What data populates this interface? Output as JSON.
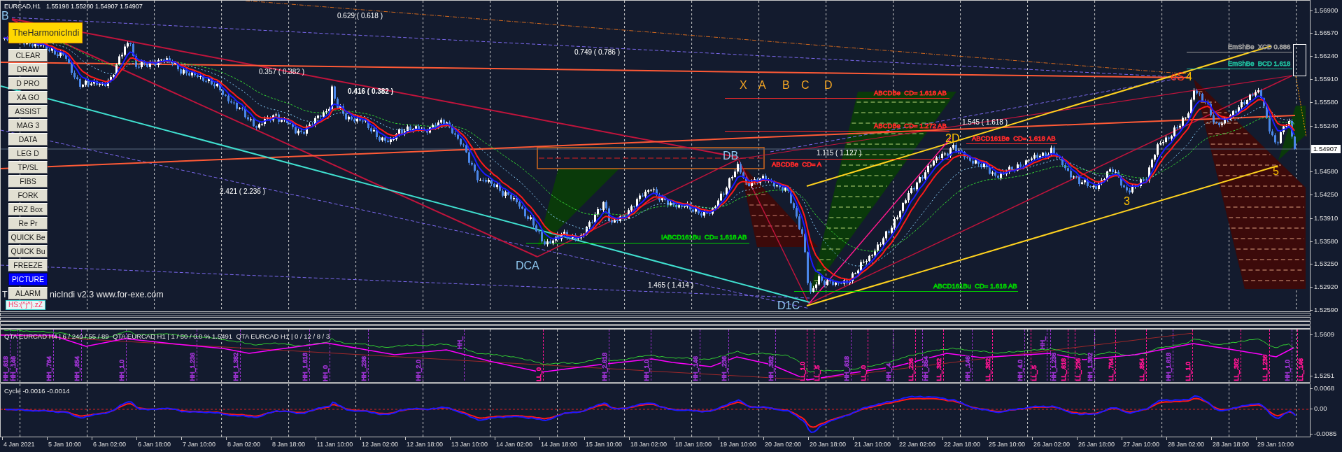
{
  "header": {
    "symbol": "EURCAD,H1",
    "quotes": [
      "1.55198",
      "1.55280",
      "1.54907",
      "1.54907"
    ]
  },
  "indicator_badge": "TheHarmonicIndi",
  "tool_buttons": [
    {
      "label": "CLEAR",
      "selected": false
    },
    {
      "label": "DRAW",
      "selected": false
    },
    {
      "label": "D PRO",
      "selected": false
    },
    {
      "label": "XA GO",
      "selected": false
    },
    {
      "label": "ASSIST",
      "selected": false
    },
    {
      "label": "MAG 3",
      "selected": false
    },
    {
      "label": "DATA",
      "selected": false
    },
    {
      "label": "LEG D",
      "selected": false
    },
    {
      "label": "TP/SL",
      "selected": false
    },
    {
      "label": "FIBS",
      "selected": false
    },
    {
      "label": "FORK",
      "selected": false
    },
    {
      "label": "PRZ Box",
      "selected": false
    },
    {
      "label": "Re Pr",
      "selected": false
    },
    {
      "label": "QUICK Be",
      "selected": false
    },
    {
      "label": "QUICK Bu",
      "selected": false
    },
    {
      "label": "FREEZE",
      "selected": false
    },
    {
      "label": "PICTURE",
      "selected": true
    },
    {
      "label": "ALARM",
      "selected": false
    }
  ],
  "indicator_caption": [
    "T",
    "nicIndi v2.3 www.for-exe.com"
  ],
  "status_tag": "HS:(^j^).zZ",
  "fib_ratio_labels": [
    "0.629 ( 0.618 )",
    "0.749 ( 0.786 )",
    "0.357 ( 0.382 )",
    "0.416 ( 0.382 )",
    "2.421 ( 2.236 )",
    "1.465 ( 1.414 )",
    "1.545 ( 1.618 )",
    "1.115 ( 1.127 )"
  ],
  "pattern_letters": [
    "X",
    "A",
    "B",
    "C",
    "D"
  ],
  "pivot_labels": [
    {
      "label": "B",
      "color": "#8fc8f0"
    },
    {
      "label": "DCA",
      "color": "#8fc8f0"
    },
    {
      "label": "DB",
      "color": "#8fc8f0"
    },
    {
      "label": "D1C",
      "color": "#8fc8f0"
    },
    {
      "label": "2D",
      "color": "#ffc200"
    },
    {
      "label": "3",
      "color": "#ffc200"
    },
    {
      "label": "5",
      "color": "#ffc200"
    },
    {
      "label": "eS",
      "color": "#ff3b1f"
    },
    {
      "label": "4",
      "color": "#ffc200"
    }
  ],
  "pattern_tags": [
    {
      "label": "IABCD161Bu  CD= 1.618 AB",
      "color": "#00d000"
    },
    {
      "label": "ABCD161Bu  CD= 1.618 AB",
      "color": "#00d000"
    },
    {
      "label": "ABCDBe  CD= 1.618 AB",
      "color": "#ff2a2a"
    },
    {
      "label": "ABCDBe  CD= 1.272 AB",
      "color": "#ff2a2a"
    },
    {
      "label": "ABCD161Be  CD= 1.618 AB",
      "color": "#ff2a2a"
    },
    {
      "label": "ABCDBe  CD= A",
      "color": "#ff2a2a"
    },
    {
      "label": "EmShBe  XCD 0.886",
      "color": "#9a9a9a"
    },
    {
      "label": "EmShBe  BCD 1.618",
      "color": "#1fb89a"
    }
  ],
  "price_axis": {
    "ticks": [
      "1.56900",
      "1.56570",
      "1.56240",
      "1.55910",
      "1.55580",
      "1.55240",
      "1.54580",
      "1.54250",
      "1.53910",
      "1.53580",
      "1.53250",
      "1.52920",
      "1.52590"
    ],
    "current_price": "1.54907"
  },
  "qta_panel": {
    "caption": "QTA EURCAD H4 | 6 / 240 / 55 / 89  QTA EURCAD H1 | 1 / 50 / 0.0 % 1.5491  QTA EURCAD H1 | 0 / 12 / 8 / 3",
    "axis_ticks": [
      "1.5609",
      "1.5251"
    ],
    "markers": [
      {
        "label": "HH_.618",
        "color": "#9932cc"
      },
      {
        "label": "HH_.146",
        "color": "#9932cc"
      },
      {
        "label": "HH_.764",
        "color": "#9932cc"
      },
      {
        "label": "HH_.854",
        "color": "#9932cc"
      },
      {
        "label": "HH_1.0",
        "color": "#9932cc"
      },
      {
        "label": "HH_1.236",
        "color": "#9932cc"
      },
      {
        "label": "HH_1.382",
        "color": "#9932cc"
      },
      {
        "label": "HH_1.618",
        "color": "#9932cc"
      },
      {
        "label": "HH_0",
        "color": "#9932cc"
      },
      {
        "label": "HH_.236",
        "color": "#9932cc"
      },
      {
        "label": "HH_2.0",
        "color": "#9932cc"
      },
      {
        "label": "HH_",
        "color": "#9932cc"
      },
      {
        "label": "LL_0",
        "color": "#ff1493"
      },
      {
        "label": "HH_2.618",
        "color": "#9932cc"
      },
      {
        "label": "HH_1.0",
        "color": "#9932cc"
      },
      {
        "label": "HH_.146",
        "color": "#9932cc"
      },
      {
        "label": "HH_.236",
        "color": "#9932cc"
      },
      {
        "label": "HH_.382",
        "color": "#9932cc"
      },
      {
        "label": "LL_1.0",
        "color": "#ff1493"
      },
      {
        "label": "LL_.5",
        "color": "#ff1493"
      },
      {
        "label": "HH_.618",
        "color": "#9932cc"
      },
      {
        "label": "LL_.0",
        "color": "#ff1493"
      },
      {
        "label": "HH_.4",
        "color": "#9932cc"
      },
      {
        "label": "LL_.236",
        "color": "#ff1493"
      },
      {
        "label": "HH_.854",
        "color": "#9932cc"
      },
      {
        "label": "LL_.382",
        "color": "#ff1493"
      },
      {
        "label": "HH_.146",
        "color": "#9932cc"
      },
      {
        "label": "LL_.382",
        "color": "#ff1493"
      },
      {
        "label": "HH_4.0",
        "color": "#9932cc"
      },
      {
        "label": "LL_.5",
        "color": "#ff1493"
      },
      {
        "label": "HH_",
        "color": "#9932cc"
      },
      {
        "label": "HH_1.236",
        "color": "#9932cc"
      },
      {
        "label": "LL_.618",
        "color": "#ff1493"
      },
      {
        "label": "LL_.236",
        "color": "#ff1493"
      },
      {
        "label": "HH_1.382",
        "color": "#9932cc"
      },
      {
        "label": "LL_.764",
        "color": "#ff1493"
      },
      {
        "label": "LL_.854",
        "color": "#ff1493"
      },
      {
        "label": "HH_1.618",
        "color": "#9932cc"
      },
      {
        "label": "LL_1.0",
        "color": "#ff1493"
      },
      {
        "label": "LL_.382",
        "color": "#ff1493"
      },
      {
        "label": "LL_1.236",
        "color": "#ff1493"
      },
      {
        "label": "HH_1.0",
        "color": "#9932cc"
      },
      {
        "label": "LL_.146",
        "color": "#ff1493"
      }
    ]
  },
  "cycle_panel": {
    "caption": "Cycle -0.0016 -0.0014",
    "axis_ticks": [
      "0.0068",
      "0.00",
      "-0.0085"
    ]
  },
  "time_axis": [
    "4 Jan 2021",
    "5 Jan 10:00",
    "6 Jan 02:00",
    "6 Jan 18:00",
    "7 Jan 10:00",
    "8 Jan 02:00",
    "8 Jan 18:00",
    "11 Jan 10:00",
    "12 Jan 02:00",
    "12 Jan 18:00",
    "13 Jan 10:00",
    "14 Jan 02:00",
    "14 Jan 18:00",
    "15 Jan 10:00",
    "18 Jan 02:00",
    "18 Jan 18:00",
    "19 Jan 10:00",
    "20 Jan 02:00",
    "20 Jan 18:00",
    "21 Jan 10:00",
    "22 Jan 02:00",
    "22 Jan 18:00",
    "25 Jan 10:00",
    "26 Jan 02:00",
    "26 Jan 18:00",
    "27 Jan 10:00",
    "28 Jan 02:00",
    "28 Jan 18:00",
    "29 Jan 10:00"
  ]
}
